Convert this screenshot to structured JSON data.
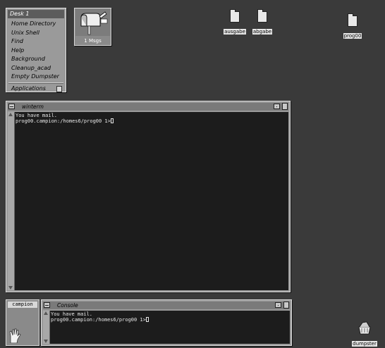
{
  "desk_menu": {
    "title": "Desk 1",
    "items": [
      {
        "label": "Home Directory"
      },
      {
        "label": "Unix Shell"
      },
      {
        "label": "Find"
      },
      {
        "label": "Help"
      },
      {
        "label": "Background"
      },
      {
        "label": "Cleanup_acad"
      },
      {
        "label": "Empty Dumpster"
      }
    ],
    "applications_label": "Applications"
  },
  "mailbox": {
    "label": "1 Msgs",
    "icon": "mailbox-icon"
  },
  "desktop_icons": [
    {
      "label": "ausgabe",
      "icon": "folder-icon"
    },
    {
      "label": "abgabe",
      "icon": "folder-icon"
    },
    {
      "label": "prog00",
      "icon": "folder-icon"
    }
  ],
  "winterm": {
    "title": "winterm",
    "lines": [
      "You have mail.",
      "prog00.campion:/homes6/prog00 1>"
    ]
  },
  "console": {
    "title": "Console",
    "lines": [
      "You have mail.",
      "prog00.campion:/homes6/prog00 1>"
    ]
  },
  "user_panel": {
    "label": "campion"
  },
  "dumpster": {
    "label": "dumpster",
    "icon": "dumpster-icon"
  },
  "colors": {
    "desktop": "#3a3a3a",
    "window_frame": "#9a9a9a",
    "terminal_bg": "#1c1c1c",
    "terminal_fg": "#e8e8e8"
  }
}
